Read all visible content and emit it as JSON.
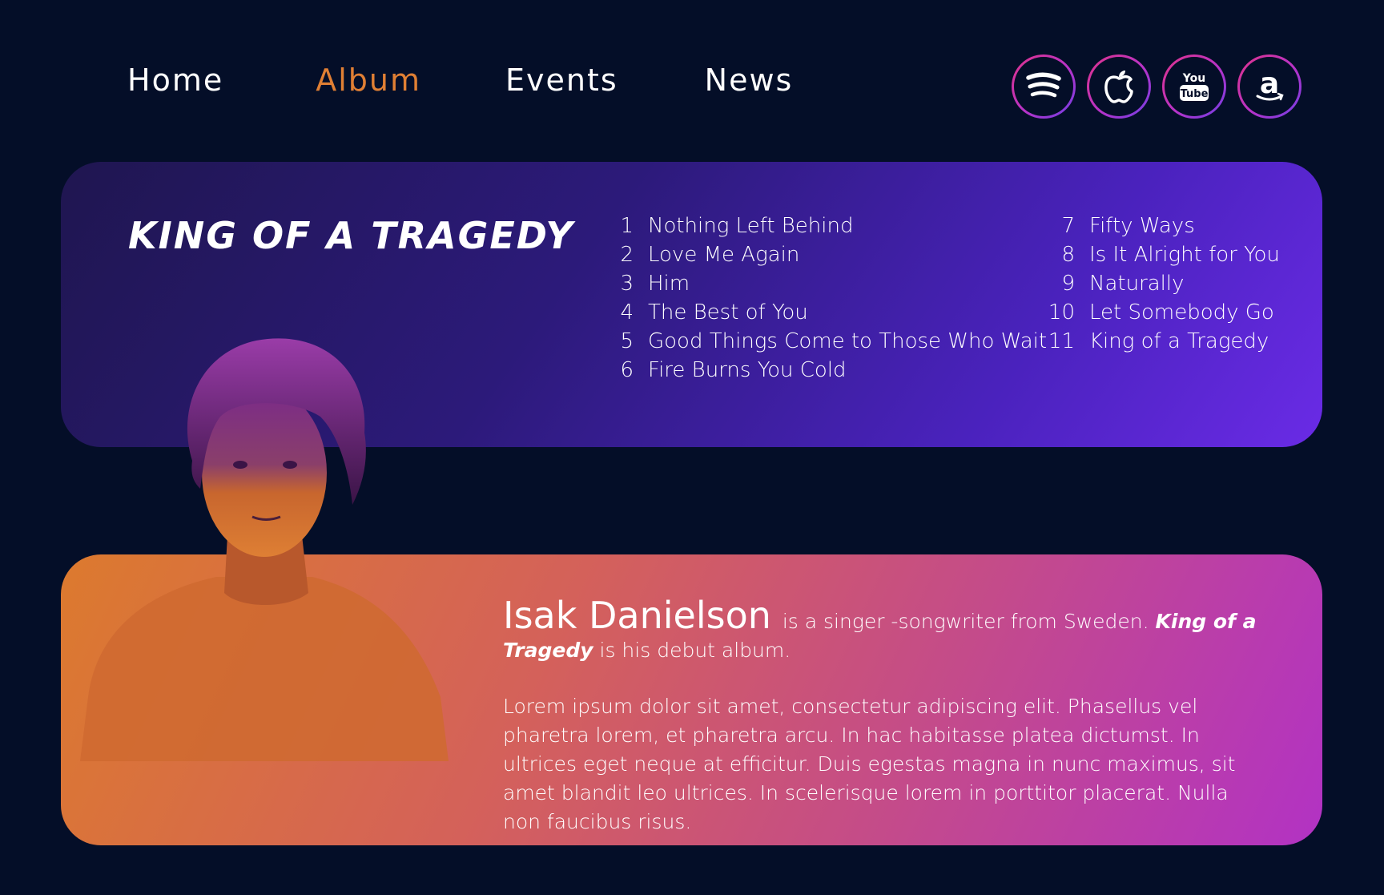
{
  "nav": {
    "items": [
      {
        "label": "Home",
        "active": false
      },
      {
        "label": "Album",
        "active": true
      },
      {
        "label": "Events",
        "active": false
      },
      {
        "label": "News",
        "active": false
      }
    ]
  },
  "socials": [
    {
      "icon": "spotify-icon"
    },
    {
      "icon": "apple-music-icon"
    },
    {
      "icon": "youtube-icon",
      "text_top": "You",
      "text_bottom": "Tube"
    },
    {
      "icon": "amazon-music-icon",
      "text": "a"
    }
  ],
  "album": {
    "title": "KING OF A TRAGEDY",
    "tracks_left": [
      {
        "num": "1",
        "title": "Nothing Left Behind"
      },
      {
        "num": "2",
        "title": "Love Me Again"
      },
      {
        "num": "3",
        "title": "Him"
      },
      {
        "num": "4",
        "title": "The Best of You"
      },
      {
        "num": "5",
        "title": "Good Things Come to Those Who Wait"
      },
      {
        "num": "6",
        "title": "Fire Burns You Cold"
      }
    ],
    "tracks_right": [
      {
        "num": "7",
        "title": "Fifty Ways"
      },
      {
        "num": "8",
        "title": "Is It Alright for You"
      },
      {
        "num": "9",
        "title": "Naturally"
      },
      {
        "num": "10",
        "title": "Let Somebody Go"
      },
      {
        "num": "11",
        "title": "King of a Tragedy"
      }
    ]
  },
  "artist": {
    "name": "Isak Danielson",
    "intro_part1": "is a singer -songwriter from Sweden.",
    "album_ref": "King of a Tragedy",
    "intro_part2": "is his debut album.",
    "description": "Lorem ipsum dolor sit amet, consectetur adipiscing elit. Phasellus vel pharetra lorem, et pharetra arcu. In hac habitasse platea dictumst. In ultrices eget neque at efficitur. Duis egestas magna in nunc maximus, sit amet blandit leo ultrices. In scelerisque lorem in porttitor placerat. Nulla non faucibus risus."
  },
  "colors": {
    "background": "#040e28",
    "nav_active": "#e07f34",
    "album_card_start": "#1f1650",
    "album_card_end": "#6a2be6",
    "artist_card_start": "#dc7a2e",
    "artist_card_end": "#b232c4"
  }
}
